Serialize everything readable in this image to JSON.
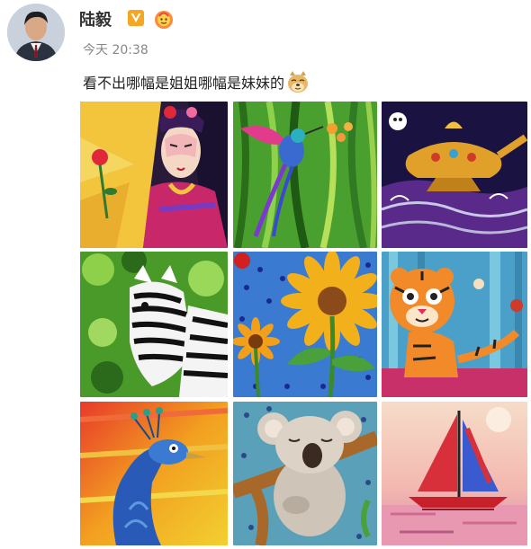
{
  "post": {
    "username": "陆毅",
    "timestamp": "今天 20:38",
    "text": "看不出哪幅是姐姐哪幅是妹妹的"
  },
  "icons": {
    "verified": "verified-v-icon",
    "fan_badge": "fan-badge-icon",
    "emoji": "doge-emoji-icon"
  },
  "colors": {
    "verified_badge": "#f5a623",
    "fan_badge": "#ff8a3d"
  },
  "images": [
    {
      "subject": "peking-opera-painting"
    },
    {
      "subject": "hummingbird-painting"
    },
    {
      "subject": "magic-lamp-painting"
    },
    {
      "subject": "zebra-painting"
    },
    {
      "subject": "sunflower-painting"
    },
    {
      "subject": "tiger-painting"
    },
    {
      "subject": "peacock-painting"
    },
    {
      "subject": "koala-painting"
    },
    {
      "subject": "sailboat-painting"
    }
  ]
}
